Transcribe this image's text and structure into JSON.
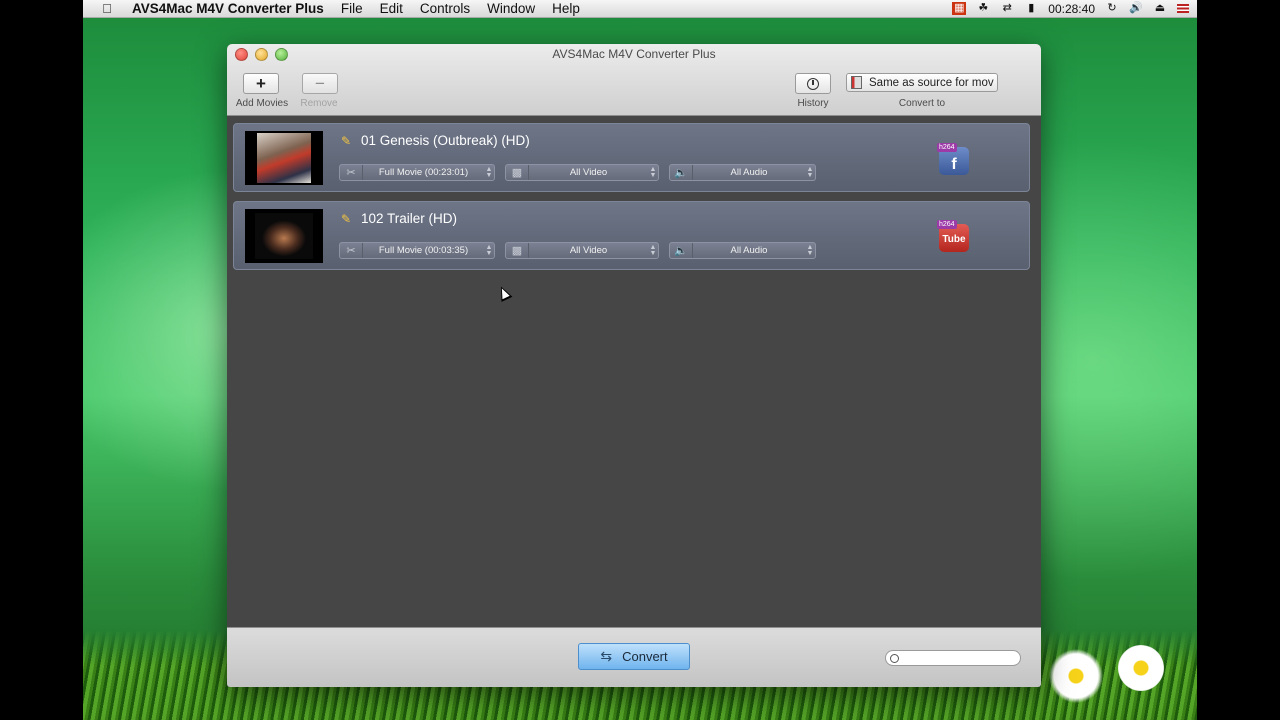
{
  "menubar": {
    "app_name": "AVS4Mac M4V Converter Plus",
    "items": [
      "File",
      "Edit",
      "Controls",
      "Window",
      "Help"
    ],
    "clock": "00:28:40"
  },
  "window": {
    "title": "AVS4Mac M4V Converter Plus",
    "toolbar": {
      "add_label": "Add Movies",
      "remove_label": "Remove",
      "history_label": "History",
      "convert_to_label": "Convert to",
      "format_value": "Same as source for mov"
    },
    "movies": [
      {
        "title": "01 Genesis (Outbreak) (HD)",
        "duration": "Full Movie (00:23:01)",
        "video": "All Video",
        "audio": "All Audio",
        "profile_tag": "h264",
        "profile_icon": "facebook-icon",
        "profile_letter": "f",
        "profile_color": "#3b5998"
      },
      {
        "title": "102 Trailer (HD)",
        "duration": "Full Movie (00:03:35)",
        "video": "All Video",
        "audio": "All Audio",
        "profile_tag": "h264",
        "profile_icon": "youtube-icon",
        "profile_letter": "Tube",
        "profile_color": "#c4302b"
      }
    ],
    "bottom": {
      "convert_label": "Convert",
      "search_placeholder": ""
    }
  }
}
